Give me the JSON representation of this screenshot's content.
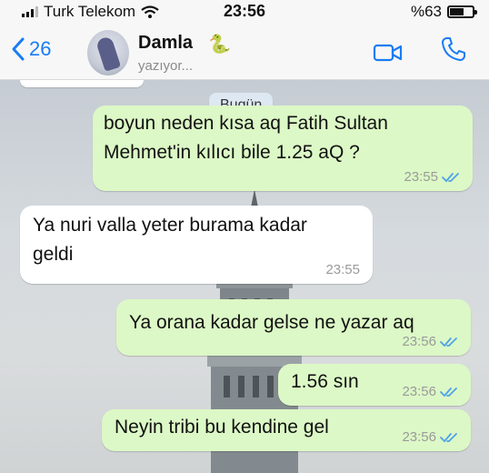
{
  "status_bar": {
    "carrier": "Turk Telekom",
    "time": "23:56",
    "battery_percent": "%63",
    "battery_level": 0.63
  },
  "header": {
    "back_count": "26",
    "contact_name": "Damla",
    "contact_emoji": "🐍",
    "contact_status": "yazıyor..."
  },
  "chat": {
    "date_label": "Bugün",
    "messages": [
      {
        "direction": "out",
        "text": "boyun neden kısa aq Fatih Sultan\nMehmet'in kılıcı bile 1.25 aQ ?",
        "time": "23:55",
        "read": true
      },
      {
        "direction": "in",
        "text": "Ya nuri valla yeter burama kadar\ngeldi",
        "time": "23:55"
      },
      {
        "direction": "out",
        "text": "Ya orana kadar gelse ne yazar aq",
        "time": "23:56",
        "read": true
      },
      {
        "direction": "out",
        "text": "1.56 sın",
        "time": "23:56",
        "read": true
      },
      {
        "direction": "out",
        "text": "Neyin tribi bu kendine gel",
        "time": "23:56",
        "read": true
      }
    ]
  },
  "colors": {
    "accent": "#1a7cf4",
    "outgoing_bubble": "#dcf8c6",
    "incoming_bubble": "#ffffff",
    "read_ticks": "#4fa3e8"
  },
  "icons": {
    "back": "chevron-left-icon",
    "video": "video-camera-icon",
    "call": "phone-icon",
    "wifi": "wifi-icon",
    "signal": "signal-icon",
    "battery": "battery-icon",
    "read": "double-check-icon"
  }
}
